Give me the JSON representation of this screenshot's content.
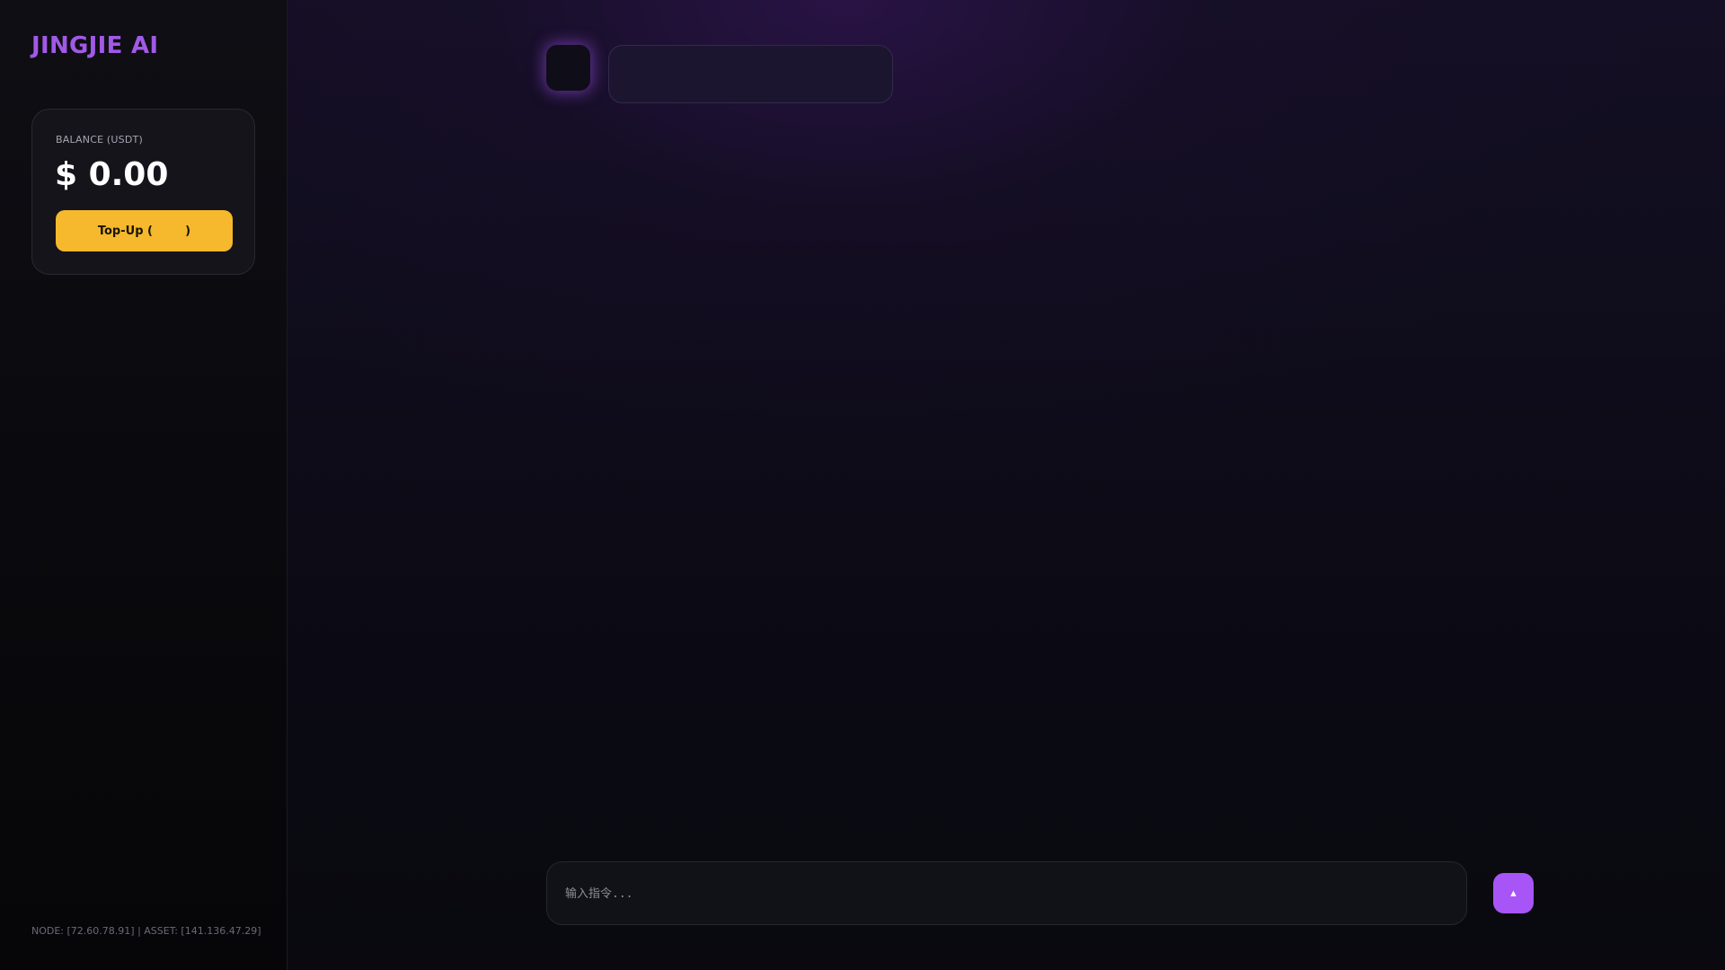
{
  "sidebar": {
    "brand": "JINGJIE AI",
    "balance": {
      "label": "BALANCE (USDT)",
      "value": "$ 0.00"
    },
    "topup_label": "Top-Up (        )",
    "footer": "NODE: [72.60.78.91] | ASSET: [141.136.47.29]"
  },
  "composer": {
    "placeholder": "输入指令...",
    "send_icon": "▲",
    "send_icon_name": "send-arrow-icon"
  },
  "colors": {
    "accent": "#a855f7",
    "brand": "#a259e6",
    "topup": "#f6b82c"
  }
}
